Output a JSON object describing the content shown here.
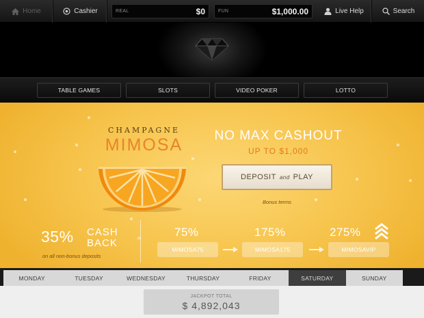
{
  "topbar": {
    "home_label": "Home",
    "cashier_label": "Cashier",
    "real_label": "REAL",
    "real_value": "$0",
    "fun_label": "FUN",
    "fun_value": "$1,000.00",
    "help_label": "Live Help",
    "search_label": "Search"
  },
  "nav": [
    {
      "label": "TABLE GAMES"
    },
    {
      "label": "SLOTS"
    },
    {
      "label": "VIDEO POKER"
    },
    {
      "label": "LOTTO"
    }
  ],
  "promo": {
    "title_small": "CHAMPAGNE",
    "title_large": "MIMOSA",
    "headline": "NO MAX CASHOUT",
    "subheadline": "UP TO $1,000",
    "deposit_button": {
      "pre": "DEPOSIT",
      "and": "and",
      "post": "PLAY"
    },
    "bonus_terms": "Bonus terms",
    "cashback": {
      "percent": "35%",
      "word1": "CASH",
      "word2": "BACK",
      "note": "on all non-bonus deposits"
    },
    "or_label": "or",
    "tiers": [
      {
        "percent": "75%",
        "code": "MIMOSA75"
      },
      {
        "percent": "175%",
        "code": "MIMOSA175"
      },
      {
        "percent": "275%",
        "code": "MIMOSAVIP"
      }
    ]
  },
  "days": {
    "items": [
      {
        "label": "MONDAY"
      },
      {
        "label": "TUESDAY"
      },
      {
        "label": "WEDNESDAY"
      },
      {
        "label": "THURSDAY"
      },
      {
        "label": "FRIDAY"
      },
      {
        "label": "SATURDAY"
      },
      {
        "label": "SUNDAY"
      }
    ],
    "active_day": "SATURDAY"
  },
  "jackpot": {
    "label": "JACKPOT TOTAL",
    "value": "$ 4,892,043"
  },
  "colors": {
    "accent_orange": "#e8842a",
    "banner_yellow": "#f7c54e",
    "active_day_bg": "#3e3e3e"
  },
  "icons": [
    "home-icon",
    "cashier-icon",
    "user-icon",
    "search-icon",
    "diamond-logo",
    "orange-slice-image",
    "chevron-up-icon",
    "arrow-right-icon"
  ]
}
